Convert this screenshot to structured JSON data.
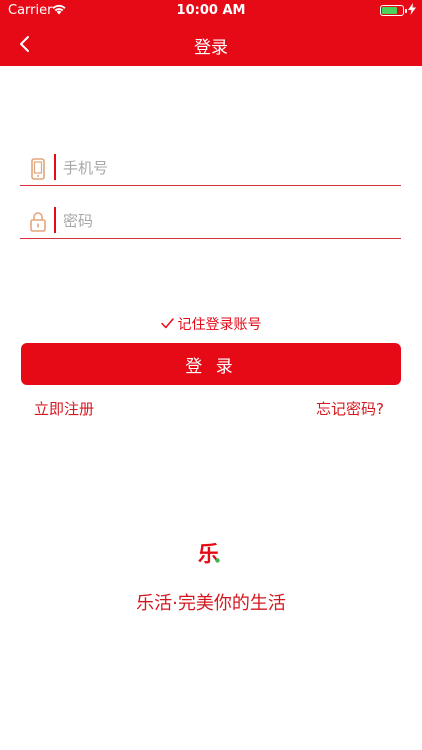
{
  "status_bar": {
    "carrier": "Carrier",
    "time": "10:00 AM"
  },
  "nav": {
    "title": "登录"
  },
  "form": {
    "phone_placeholder": "手机号",
    "password_placeholder": "密码",
    "phone_value": "",
    "password_value": ""
  },
  "remember": {
    "label": "记住登录账号",
    "checked": true
  },
  "actions": {
    "login_label": "登 录",
    "register_label": "立即注册",
    "forgot_label": "忘记密码?"
  },
  "branding": {
    "logo_text": "乐",
    "slogan": "乐活·完美你的生活"
  },
  "colors": {
    "primary": "#e60a17",
    "field_icon": "#e3a57b",
    "logo_green": "#3cb54a"
  }
}
